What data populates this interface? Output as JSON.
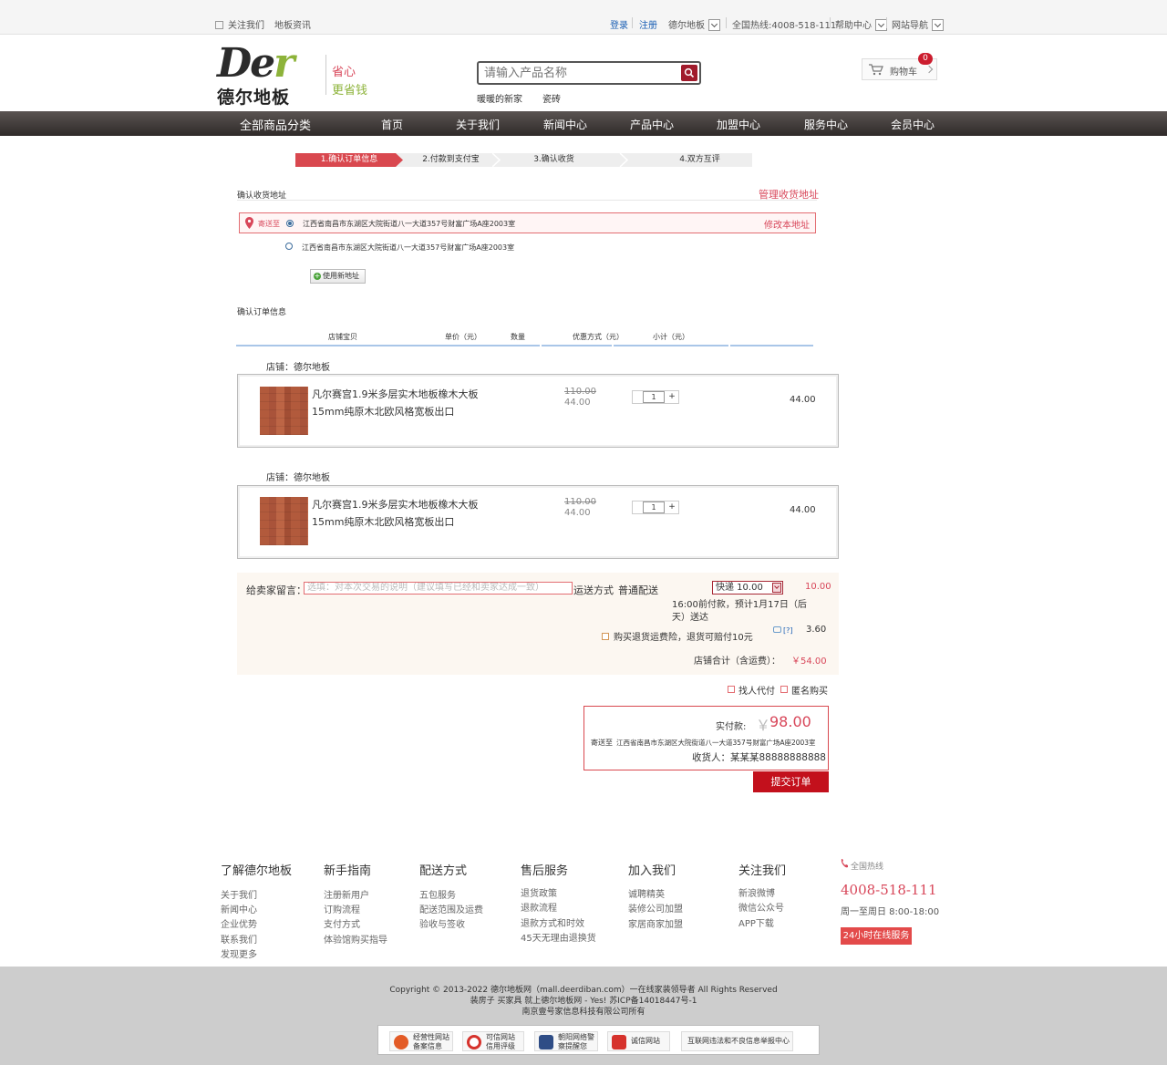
{
  "topbar": {
    "follow": "关注我们",
    "news": "地板资讯",
    "login": "登录",
    "register": "注册",
    "site": "德尔地板",
    "hotline": "全国热线:4008-518-111",
    "help": "帮助中心",
    "sitenav": "网站导航"
  },
  "header": {
    "logo_en_a": "De",
    "logo_en_b": "r",
    "logo_cn": "德尔地板",
    "slogan1": "省心",
    "slogan2": "更省钱",
    "search_placeholder": "请输入产品名称",
    "hot1": "暖暖的新家",
    "hot2": "瓷砖",
    "cart_label": "购物车",
    "cart_count": "0"
  },
  "nav": {
    "all": "全部商品分类",
    "items": [
      "首页",
      "关于我们",
      "新闻中心",
      "产品中心",
      "加盟中心",
      "服务中心",
      "会员中心"
    ]
  },
  "steps": [
    "1.确认订单信息",
    "2.付款到支付宝",
    "3.确认收货",
    "4.双方互评"
  ],
  "address": {
    "title": "确认收货地址",
    "manage": "管理收货地址",
    "send_to": "寄送至",
    "addr1": "江西省南昌市东湖区大院街道八一大道357号财富广场A座2003室",
    "modify": "修改本地址",
    "addr2": "江西省南昌市东湖区大院街道八一大道357号财富广场A座2003室",
    "use_new": "使用新地址"
  },
  "order": {
    "title": "确认订单信息",
    "headers": [
      "店铺宝贝",
      "单价（元）",
      "数量",
      "优惠方式（元）",
      "小计（元）"
    ],
    "items": [
      {
        "shop": "店铺：德尔地板",
        "name": "凡尔赛宫1.9米多层实木地板橡木大板15mm纯原木北欧风格宽板出口",
        "old_price": "110.00",
        "price": "44.00",
        "qty": "1",
        "subtotal": "44.00"
      },
      {
        "shop": "店铺：德尔地板",
        "name": "凡尔赛宫1.9米多层实木地板橡木大板15mm纯原木北欧风格宽板出口",
        "old_price": "110.00",
        "price": "44.00",
        "qty": "1",
        "subtotal": "44.00"
      }
    ]
  },
  "summary": {
    "msg_label": "给卖家留言：",
    "msg_placeholder": "选填：对本次交易的说明（建议填写已经和卖家达成一致）",
    "ship_label": "运送方式",
    "ship_type": "普通配送",
    "ship_select": "快递 10.00",
    "ship_fee": "10.00",
    "delivery_note": "16:00前付款，预计1月17日（后天）送达",
    "insurance": "购买退货运费险，退货可赔付10元",
    "insurance_help": "[?]",
    "insurance_fee": "3.60",
    "shop_total_label": "店铺合计（含运费）：",
    "shop_total": "￥54.00",
    "proxy_pay": "找人代付",
    "anonymous": "匿名购买"
  },
  "payment": {
    "label": "实付款:",
    "yen": "￥",
    "amount": "98.00",
    "send_to": "寄送至",
    "address": "江西省南昌市东湖区大院街道八一大道357号财富广场A座2003室",
    "receiver": "收货人：某某某88888888888",
    "submit": "提交订单"
  },
  "footer": {
    "cols": [
      {
        "title": "了解德尔地板",
        "items": [
          "关于我们",
          "新闻中心",
          "企业优势",
          "联系我们",
          "发现更多"
        ]
      },
      {
        "title": "新手指南",
        "items": [
          "注册新用户",
          "订购流程",
          "支付方式",
          "体验馆购买指导"
        ]
      },
      {
        "title": "配送方式",
        "items": [
          "五包服务",
          "配送范围及运费",
          "验收与签收"
        ]
      },
      {
        "title": "售后服务",
        "items": [
          "退货政策",
          "退款流程",
          "退款方式和时效",
          "45天无理由退换货"
        ]
      },
      {
        "title": "加入我们",
        "items": [
          "诚聘精英",
          "装修公司加盟",
          "家居商家加盟"
        ]
      },
      {
        "title": "关注我们",
        "items": [
          "新浪微博",
          "微信公众号",
          "APP下载"
        ]
      }
    ],
    "hotline_label": "全国热线",
    "phone": "4008-518-111",
    "hours": "周一至周日 8:00-18:00",
    "online": "24小时在线服务",
    "copyright1": "Copyright © 2013-2022 德尔地板网（mall.deerdiban.com）一在线家装领导者 All Rights Reserved",
    "copyright2": "装房子 买家具 就上德尔地板网 - Yes! 苏ICP备14018447号-1",
    "copyright3": "南京壹号家信息科技有限公司所有",
    "badges": [
      {
        "l1": "经营性网站",
        "l2": "备案信息"
      },
      {
        "l1": "可信网站",
        "l2": "信用评级"
      },
      {
        "l1": "朝阳网络警",
        "l2": "察提醒您"
      },
      {
        "l1": "诚信网站",
        "l2": ""
      },
      {
        "l1": "互联网违法和不良信息举报中心",
        "l2": ""
      }
    ]
  },
  "colors": {
    "accent": "#d9484f",
    "submit": "#c3101c",
    "nav": "#3d3837",
    "green": "#8db33a"
  }
}
